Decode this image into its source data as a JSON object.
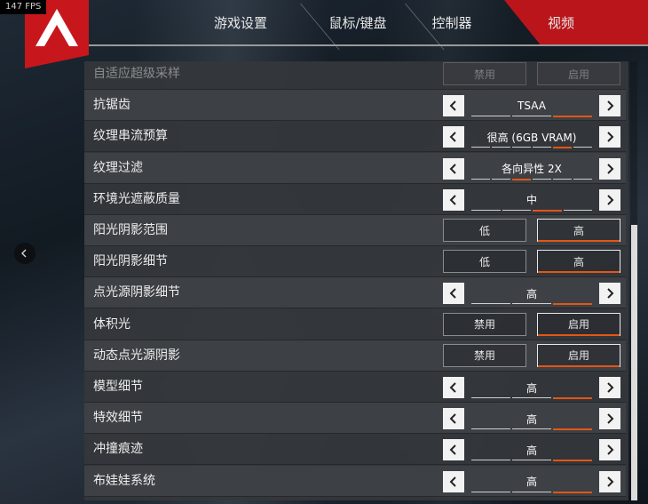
{
  "fps": "147 FPS",
  "tabs": [
    {
      "label": "游戏设置"
    },
    {
      "label": "鼠标/键盘"
    },
    {
      "label": "控制器"
    },
    {
      "label": "视频"
    }
  ],
  "active_tab": "视频",
  "colors": {
    "accent": "#e25616",
    "brand_red": "#c8171c",
    "tab_active": "#b9151b"
  },
  "settings": [
    {
      "label": "自适应超级采样",
      "type": "toggle",
      "options": [
        "禁用",
        "启用"
      ],
      "selected": 0,
      "disabled": true
    },
    {
      "label": "抗锯齿",
      "type": "selector",
      "value": "TSAA",
      "level": 3,
      "levels": 3
    },
    {
      "label": "纹理串流预算",
      "type": "selector",
      "value": "很高 (6GB VRAM)",
      "level": 5,
      "levels": 6
    },
    {
      "label": "纹理过滤",
      "type": "selector",
      "value": "各向异性 2X",
      "level": 3,
      "levels": 6
    },
    {
      "label": "环境光遮蔽质量",
      "type": "selector",
      "value": "中",
      "level": 3,
      "levels": 4
    },
    {
      "label": "阳光阴影范围",
      "type": "toggle",
      "options": [
        "低",
        "高"
      ],
      "selected": 1
    },
    {
      "label": "阳光阴影细节",
      "type": "toggle",
      "options": [
        "低",
        "高"
      ],
      "selected": 1
    },
    {
      "label": "点光源阴影细节",
      "type": "selector",
      "value": "高",
      "level": 3,
      "levels": 3
    },
    {
      "label": "体积光",
      "type": "toggle",
      "options": [
        "禁用",
        "启用"
      ],
      "selected": 1
    },
    {
      "label": "动态点光源阴影",
      "type": "toggle",
      "options": [
        "禁用",
        "启用"
      ],
      "selected": 1
    },
    {
      "label": "模型细节",
      "type": "selector",
      "value": "高",
      "level": 3,
      "levels": 3
    },
    {
      "label": "特效细节",
      "type": "selector",
      "value": "高",
      "level": 3,
      "levels": 3
    },
    {
      "label": "冲撞痕迹",
      "type": "selector",
      "value": "高",
      "level": 3,
      "levels": 3
    },
    {
      "label": "布娃娃系统",
      "type": "selector",
      "value": "高",
      "level": 3,
      "levels": 3
    }
  ],
  "scroll_position": 0.45
}
